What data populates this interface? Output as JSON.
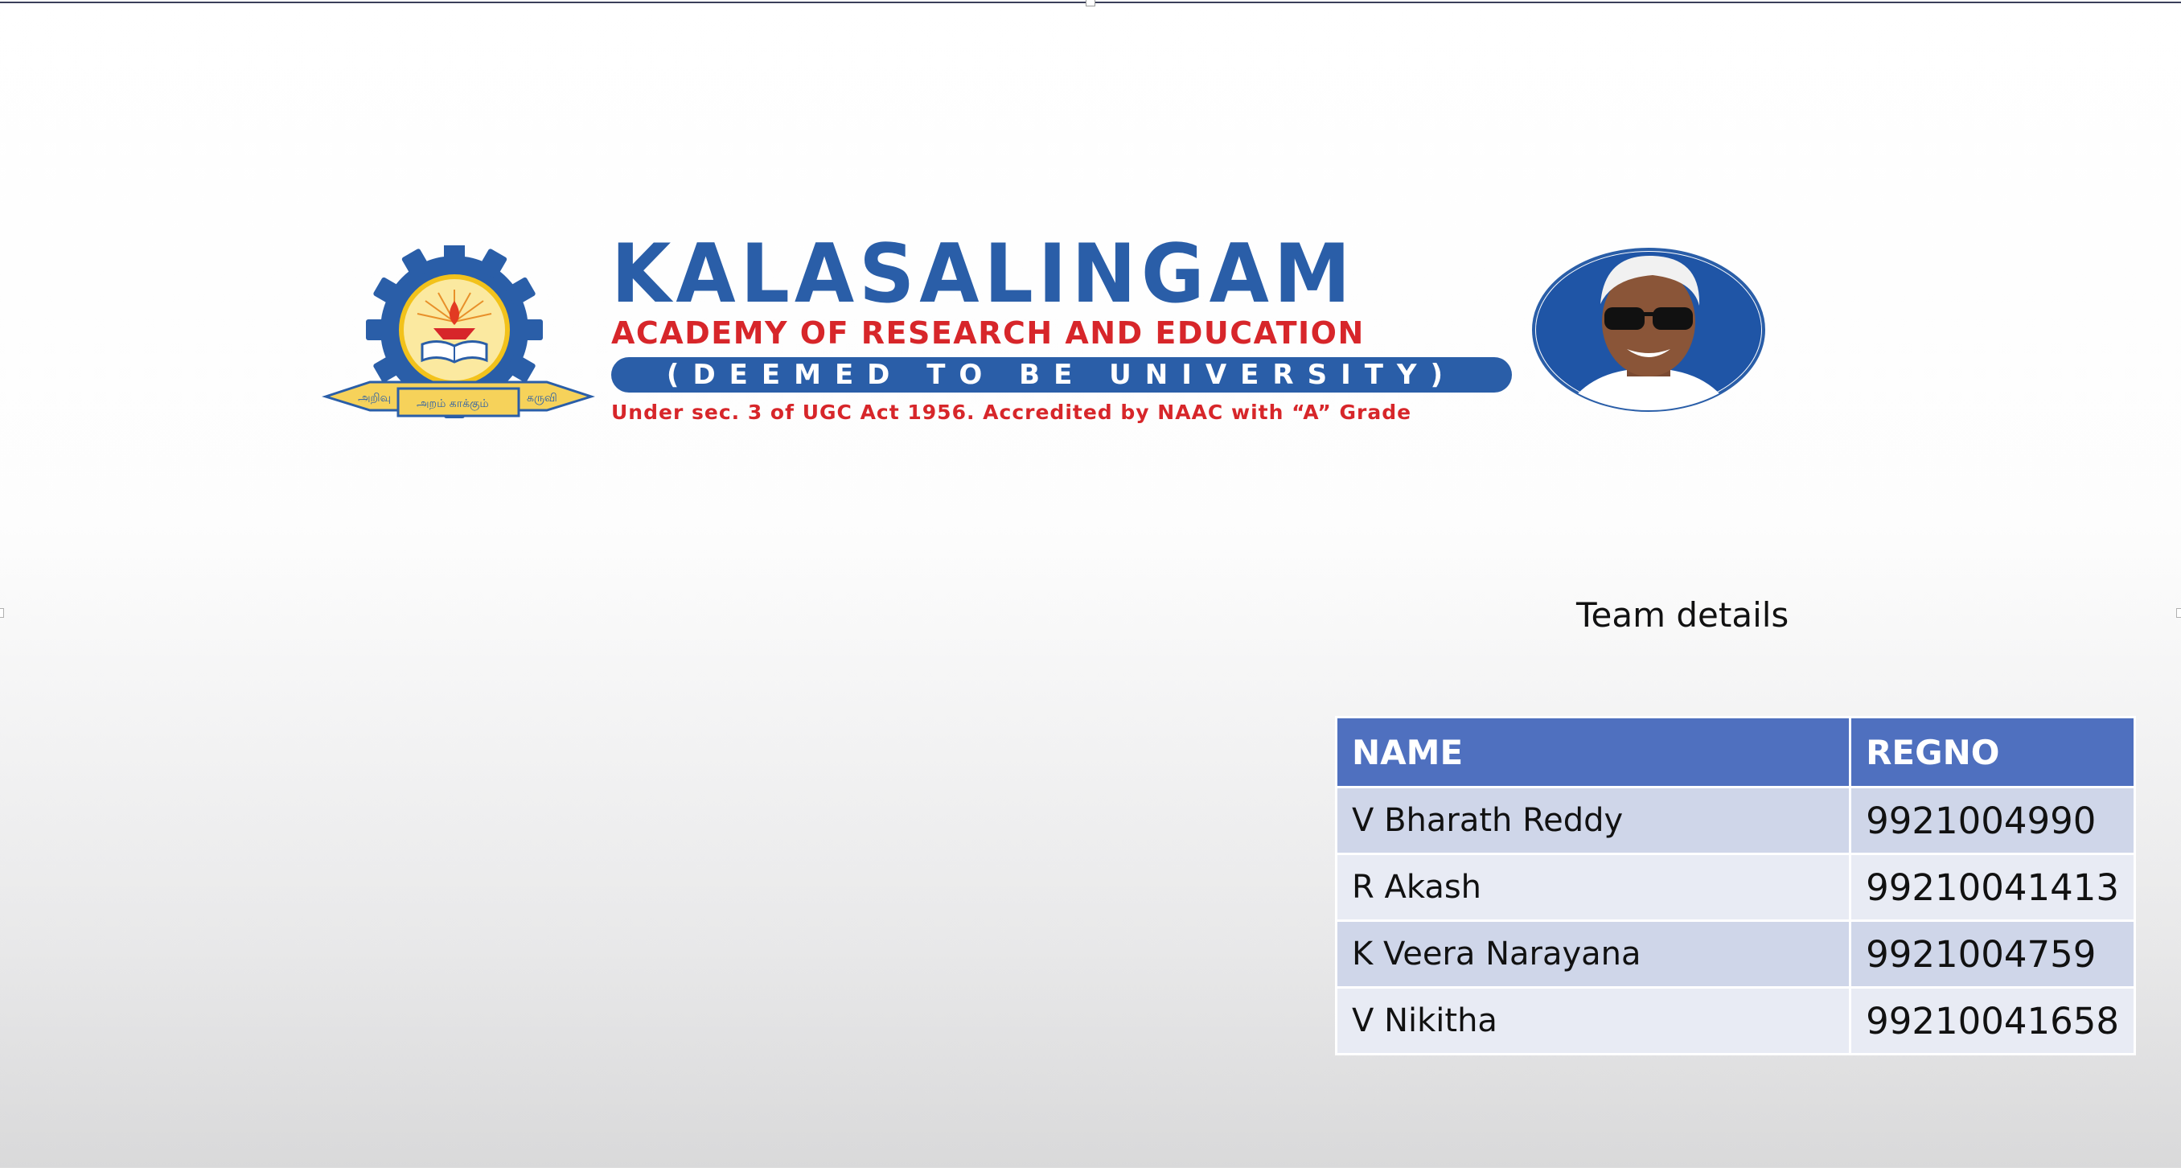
{
  "banner": {
    "institution": "KALASALINGAM",
    "subtitle": "ACADEMY OF RESEARCH AND EDUCATION",
    "status": "(DEEMED TO BE UNIVERSITY)",
    "accreditation": "Under sec. 3 of UGC Act 1956. Accredited by NAAC with “A” Grade",
    "emblem": {
      "ring_text": "KALASALINGAM ACADEMY OF RESEARCH AND EDUCATION",
      "ribbon_left": "அறிவு",
      "ribbon_center": "அறம் காக்கும்",
      "ribbon_right": "கருவி",
      "icon": "lamp-book-emblem-icon"
    },
    "portrait_icon": "founder-portrait-icon",
    "colors": {
      "blue": "#2a5ea8",
      "red": "#d7262a",
      "gold": "#f2c21b"
    }
  },
  "team": {
    "heading": "Team details",
    "columns": [
      "NAME",
      "REGNO"
    ],
    "rows": [
      {
        "name": "V Bharath Reddy",
        "regno": "9921004990"
      },
      {
        "name": "R Akash",
        "regno": "99210041413"
      },
      {
        "name": "K Veera Narayana",
        "regno": "9921004759"
      },
      {
        "name": "V Nikitha",
        "regno": "99210041658"
      }
    ],
    "colors": {
      "header": "#4f70bf",
      "row_dark": "#cfd6e9",
      "row_light": "#e8ebf4"
    }
  }
}
